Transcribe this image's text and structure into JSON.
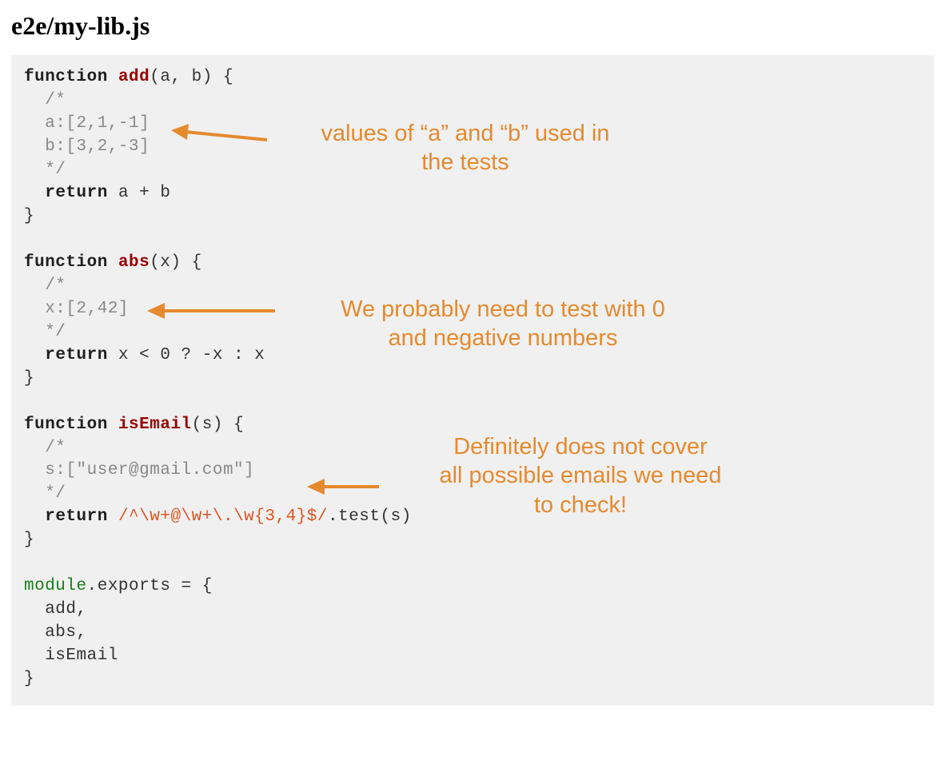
{
  "title": "e2e/my-lib.js",
  "code": {
    "fn_add": {
      "kw": "function",
      "name": "add",
      "params": "(a, b) {",
      "c1": "  /*",
      "c2": "  a:[2,1,-1]",
      "c3": "  b:[3,2,-3]",
      "c4": "  */",
      "ret_kw": "return",
      "ret_expr": " a + b",
      "close": "}"
    },
    "fn_abs": {
      "kw": "function",
      "name": "abs",
      "params": "(x) {",
      "c1": "  /*",
      "c2": "  x:[2,42]",
      "c3": "  */",
      "ret_kw": "return",
      "ret_expr": " x < 0 ? -x : x",
      "close": "}"
    },
    "fn_isEmail": {
      "kw": "function",
      "name": "isEmail",
      "params": "(s) {",
      "c1": "  /*",
      "c2": "  s:[\"user@gmail.com\"]",
      "c3": "  */",
      "ret_kw": "return",
      "regex": "/^\\w+@\\w+\\.\\w{3,4}$/",
      "ret_tail": ".test(s)",
      "close": "}"
    },
    "exports": {
      "mod": "module",
      "rest": ".exports = {",
      "l1": "  add,",
      "l2": "  abs,",
      "l3": "  isEmail",
      "close": "}"
    }
  },
  "annotations": {
    "a1": "values of “a” and “b” used in\nthe tests",
    "a2": "We probably need to test with 0\nand negative numbers",
    "a3": "Definitely does not cover\nall possible emails we need\nto check!"
  }
}
